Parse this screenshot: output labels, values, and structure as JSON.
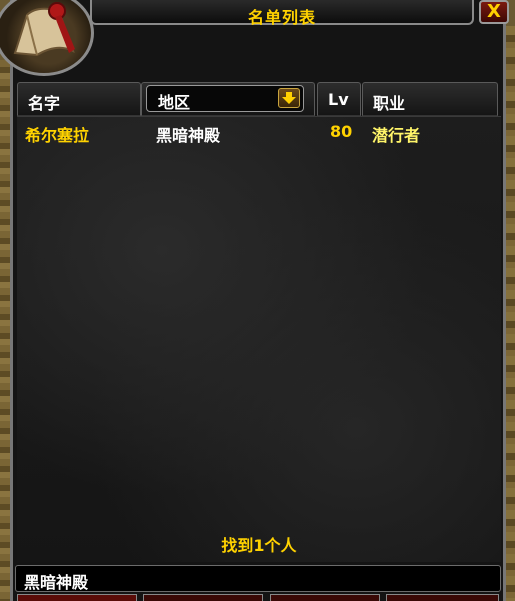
{
  "window": {
    "title": "名单列表",
    "close_label": "X"
  },
  "columns": {
    "name": "名字",
    "zone": "地区",
    "level": "Lv",
    "class": "职业"
  },
  "rows": [
    {
      "name": "希尔塞拉",
      "zone": "黑暗神殿",
      "level": "80",
      "class": "潜行者"
    }
  ],
  "footer": {
    "result_text": "找到1个人"
  },
  "search": {
    "value": "黑暗神殿"
  },
  "colors": {
    "gold": "#ffd200",
    "row_name": "#ffd200",
    "row_zone": "#ffffff",
    "row_class": "#fff569",
    "frame": "#141414"
  },
  "icons": {
    "portrait": "scroll-icon",
    "dropdown": "arrow-down-icon",
    "close": "close-icon"
  }
}
